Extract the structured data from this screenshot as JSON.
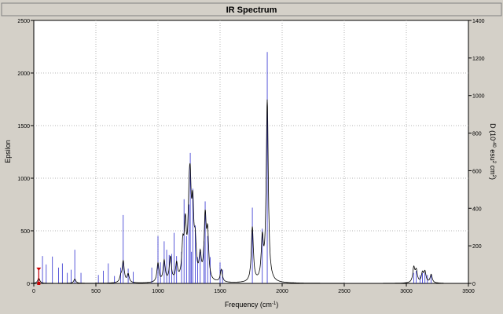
{
  "chart_data": {
    "type": "line",
    "title": "IR Spectrum",
    "xlabel": "Frequency (cm",
    "xlabel_sup": "-1",
    "xlabel_end": ")",
    "ylabel_left": "Epsilon",
    "ylabel_right_parts": [
      "D (10",
      "-40",
      " esu",
      "2",
      " cm",
      "2",
      ")"
    ],
    "xlim": [
      0,
      3500
    ],
    "ylim_left": [
      0,
      2500
    ],
    "ylim_right": [
      0,
      1400
    ],
    "x_ticks": [
      "0",
      "500",
      "1000",
      "1500",
      "2000",
      "2500",
      "3000",
      "3500"
    ],
    "y_left_ticks": [
      "0",
      "500",
      "1000",
      "1500",
      "2000",
      "2500"
    ],
    "y_right_ticks": [
      "0",
      "200",
      "400",
      "600",
      "800",
      "1000",
      "1200",
      "1400"
    ],
    "grid": true,
    "colors": {
      "spectrum": "#000000",
      "sticks": "#3030d0",
      "marker": "#cc0000",
      "grid": "#b4b4b4"
    },
    "marker_x": 40,
    "marker_y_top": 150,
    "sticks": [
      [
        40,
        140
      ],
      [
        70,
        260
      ],
      [
        100,
        180
      ],
      [
        150,
        255
      ],
      [
        200,
        150
      ],
      [
        230,
        190
      ],
      [
        270,
        100
      ],
      [
        300,
        130
      ],
      [
        330,
        320
      ],
      [
        380,
        100
      ],
      [
        520,
        80
      ],
      [
        560,
        120
      ],
      [
        600,
        190
      ],
      [
        650,
        70
      ],
      [
        700,
        150
      ],
      [
        720,
        650
      ],
      [
        760,
        140
      ],
      [
        800,
        110
      ],
      [
        950,
        150
      ],
      [
        1000,
        450
      ],
      [
        1020,
        200
      ],
      [
        1050,
        400
      ],
      [
        1070,
        320
      ],
      [
        1090,
        270
      ],
      [
        1110,
        280
      ],
      [
        1130,
        480
      ],
      [
        1150,
        260
      ],
      [
        1190,
        300
      ],
      [
        1210,
        800
      ],
      [
        1230,
        450
      ],
      [
        1250,
        750
      ],
      [
        1260,
        1240
      ],
      [
        1270,
        300
      ],
      [
        1280,
        900
      ],
      [
        1300,
        550
      ],
      [
        1320,
        250
      ],
      [
        1340,
        300
      ],
      [
        1370,
        400
      ],
      [
        1380,
        780
      ],
      [
        1400,
        450
      ],
      [
        1420,
        250
      ],
      [
        1500,
        200
      ],
      [
        1520,
        130
      ],
      [
        1760,
        720
      ],
      [
        1840,
        520
      ],
      [
        1880,
        2200
      ],
      [
        3060,
        100
      ],
      [
        3080,
        120
      ],
      [
        3110,
        80
      ],
      [
        3130,
        100
      ],
      [
        3150,
        100
      ],
      [
        3170,
        80
      ],
      [
        3200,
        90
      ]
    ],
    "peaks": [
      [
        40,
        50
      ],
      [
        330,
        40
      ],
      [
        700,
        50
      ],
      [
        720,
        200
      ],
      [
        760,
        80
      ],
      [
        1000,
        180
      ],
      [
        1050,
        200
      ],
      [
        1100,
        230
      ],
      [
        1150,
        160
      ],
      [
        1200,
        300
      ],
      [
        1220,
        480
      ],
      [
        1250,
        520
      ],
      [
        1260,
        680
      ],
      [
        1280,
        600
      ],
      [
        1300,
        300
      ],
      [
        1340,
        220
      ],
      [
        1380,
        580
      ],
      [
        1400,
        420
      ],
      [
        1510,
        120
      ],
      [
        1760,
        520
      ],
      [
        1840,
        380
      ],
      [
        1880,
        1720
      ],
      [
        3060,
        140
      ],
      [
        3080,
        110
      ],
      [
        3130,
        90
      ],
      [
        3150,
        100
      ],
      [
        3200,
        80
      ]
    ],
    "peak_width": 10
  }
}
